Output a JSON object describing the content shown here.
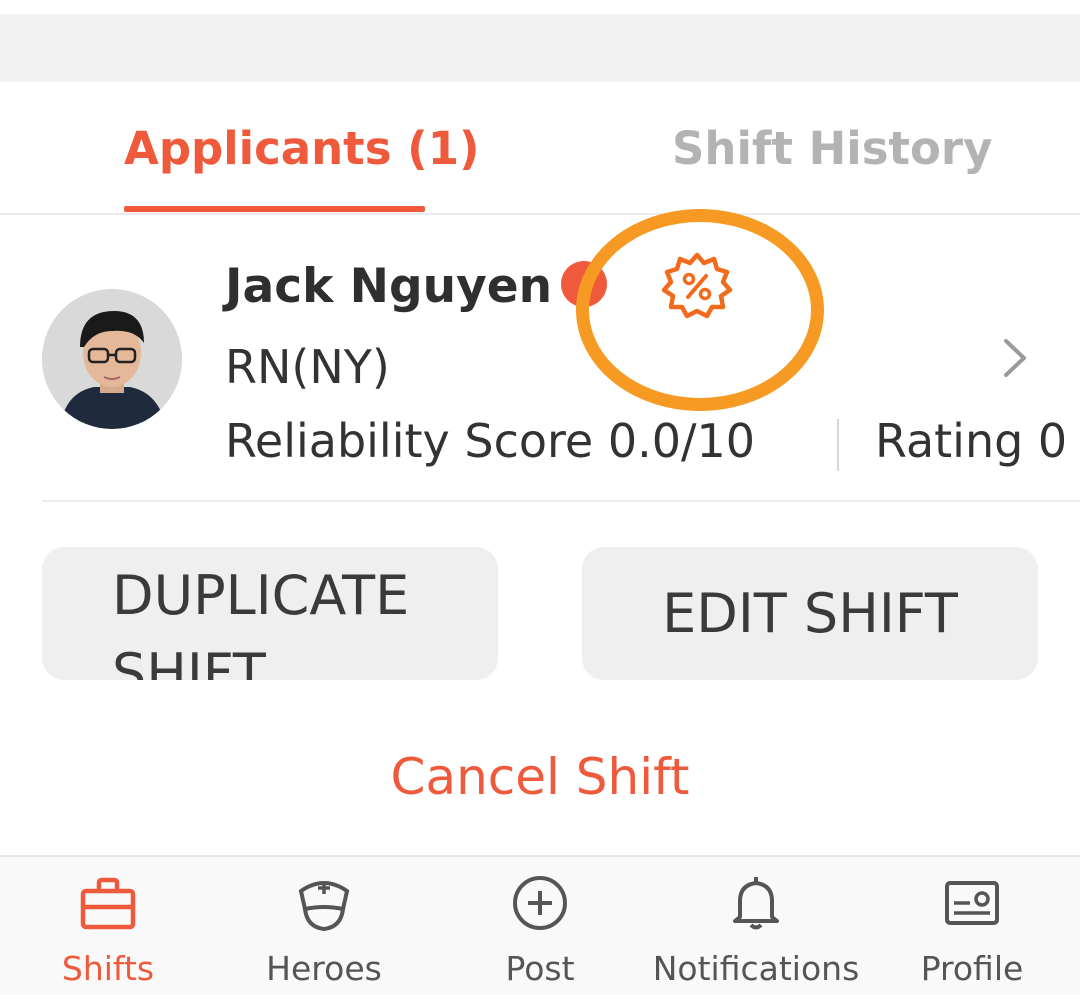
{
  "tabs": [
    {
      "label": "Applicants (1)",
      "active": true
    },
    {
      "label": "Shift History",
      "active": false
    }
  ],
  "applicant": {
    "name": "Jack Nguyen",
    "role": "RN(NY)",
    "reliability": "Reliability Score 0.0/10",
    "rating": "Rating 0",
    "avatar_icon": "user-photo",
    "badge_icon": "verified-badge-icon",
    "discount_icon": "discount-badge-icon",
    "chevron_icon": "chevron-right-icon"
  },
  "actions": {
    "duplicate_label": "DUPLICATE SHIFT",
    "edit_label": "EDIT SHIFT",
    "cancel_label": "Cancel Shift"
  },
  "nav": [
    {
      "label": "Shifts",
      "icon": "briefcase-icon",
      "active": true
    },
    {
      "label": "Heroes",
      "icon": "nurse-cap-icon",
      "active": false
    },
    {
      "label": "Post",
      "icon": "plus-circle-icon",
      "active": false
    },
    {
      "label": "Notifications",
      "icon": "bell-icon",
      "active": false
    },
    {
      "label": "Profile",
      "icon": "id-card-icon",
      "active": false
    }
  ],
  "colors": {
    "accent": "#ee5a3b",
    "highlight_ring": "#f79a24",
    "inactive_tab": "#b3b3b3",
    "button_bg": "#efefef"
  }
}
